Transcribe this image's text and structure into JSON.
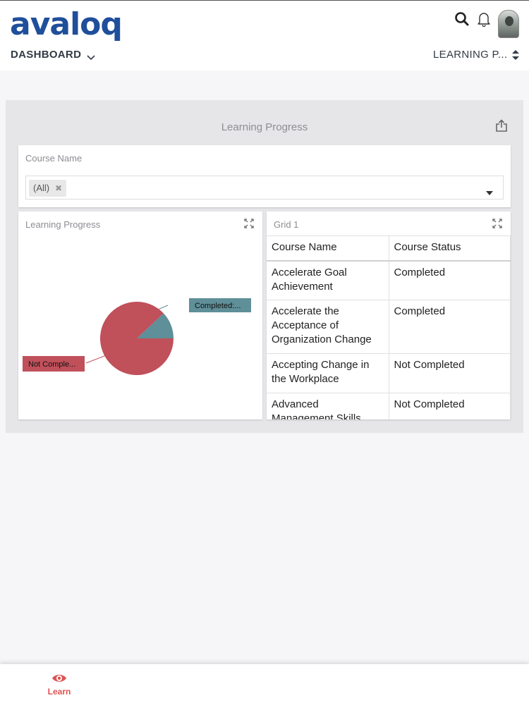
{
  "app": {
    "logo_text": "avaloq",
    "brand_color": "#1f4e9b",
    "accent_color": "#e05252"
  },
  "header": {
    "title": "DASHBOARD",
    "dashboard_selector": "LEARNING P...",
    "icons": [
      "search-icon",
      "bell-icon",
      "avatar",
      "chevron-down-icon",
      "sort-icon"
    ]
  },
  "panel": {
    "title": "Learning Progress",
    "share_icon": "share-icon"
  },
  "filter": {
    "label": "Course Name",
    "chip": "(All)",
    "chip_remove": "✖"
  },
  "pie_card": {
    "title": "Learning Progress"
  },
  "chart_data": {
    "type": "pie",
    "slices": [
      {
        "label": "Completed:...",
        "value": 12,
        "color": "#5f8f98"
      },
      {
        "label": "Not Comple...",
        "value": 88,
        "color": "#c0505a"
      }
    ]
  },
  "grid": {
    "title": "Grid 1",
    "columns": [
      "Course Name",
      "Course Status"
    ],
    "rows": [
      [
        "Accelerate Goal Achievement",
        "Completed"
      ],
      [
        "Accelerate the Acceptance of Organization Change",
        "Completed"
      ],
      [
        "Accepting Change in the Workplace",
        "Not Completed"
      ],
      [
        "Advanced Management Skills",
        "Not Completed"
      ]
    ]
  },
  "bottom_nav": {
    "items": [
      {
        "label": "Learn",
        "icon": "eye-icon"
      }
    ]
  }
}
